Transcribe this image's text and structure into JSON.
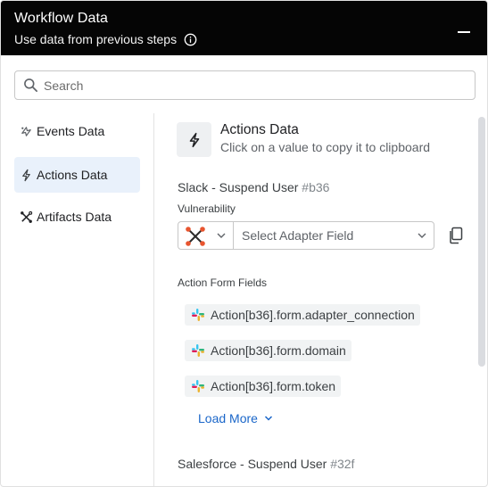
{
  "header": {
    "title": "Workflow Data",
    "subtitle": "Use data from previous steps"
  },
  "search": {
    "placeholder": "Search",
    "value": ""
  },
  "sidebar": {
    "items": [
      {
        "label": "Events Data",
        "icon": "events-icon",
        "active": false
      },
      {
        "label": "Actions Data",
        "icon": "lightning-icon",
        "active": true
      },
      {
        "label": "Artifacts Data",
        "icon": "artifacts-icon",
        "active": false
      }
    ]
  },
  "section": {
    "title": "Actions Data",
    "subtitle": "Click on a value to copy it to clipboard"
  },
  "steps": [
    {
      "name": "Slack - Suspend User",
      "hash": "#b36",
      "vulnerability_label": "Vulnerability",
      "adapter_field_placeholder": "Select Adapter Field",
      "form_fields_label": "Action Form Fields",
      "fields": [
        "Action[b36].form.adapter_connection",
        "Action[b36].form.domain",
        "Action[b36].form.token"
      ],
      "load_more": "Load More"
    },
    {
      "name": "Salesforce - Suspend User",
      "hash": "#32f"
    }
  ],
  "colors": {
    "header_bg": "#050505",
    "active_bg": "#e9f1fb",
    "link": "#1a66c9",
    "chip_bg": "#f1f3f4"
  }
}
